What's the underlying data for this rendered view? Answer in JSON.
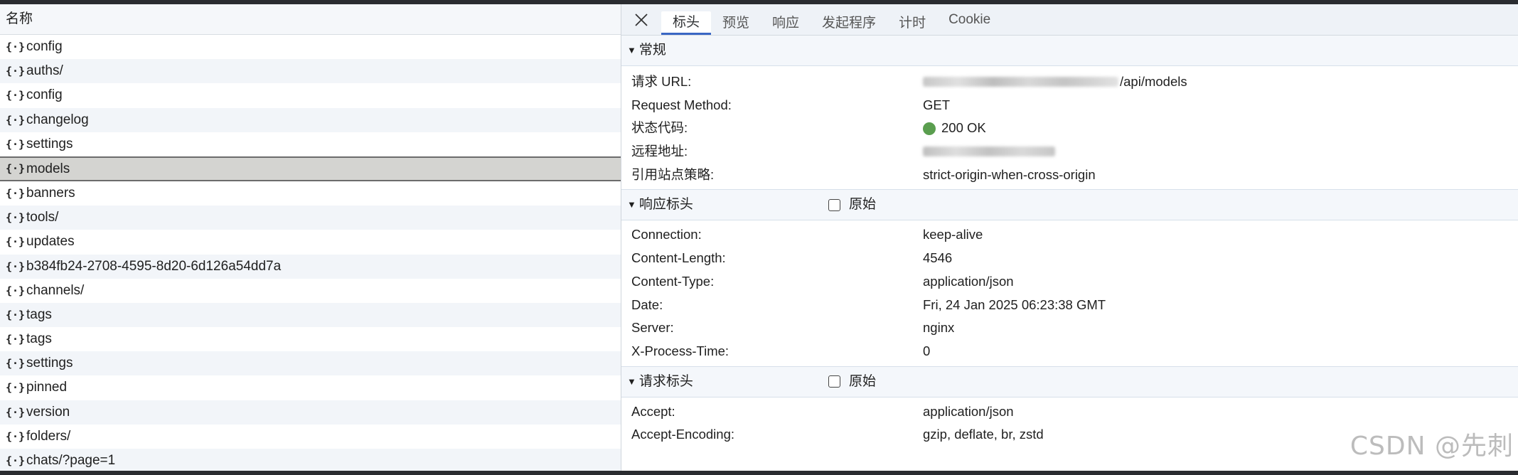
{
  "request_list": {
    "header": "名称",
    "icon": "json-braces-icon",
    "selected_index": 5,
    "items": [
      "config",
      "auths/",
      "config",
      "changelog",
      "settings",
      "models",
      "banners",
      "tools/",
      "updates",
      "b384fb24-2708-4595-8d20-6d126a54dd7a",
      "channels/",
      "tags",
      "tags",
      "settings",
      "pinned",
      "version",
      "folders/",
      "chats/?page=1"
    ]
  },
  "details": {
    "close_icon": "close-icon",
    "tabs": [
      "标头",
      "预览",
      "响应",
      "发起程序",
      "计时",
      "Cookie"
    ],
    "active_tab": "标头",
    "general": {
      "title": "常规",
      "request_url_label": "请求 URL:",
      "request_url_suffix": "/api/models",
      "method_label": "Request Method:",
      "method_value": "GET",
      "status_label": "状态代码:",
      "status_value": "200 OK",
      "status_color": "#5a9e4f",
      "remote_label": "远程地址:",
      "referrer_label": "引用站点策略:",
      "referrer_value": "strict-origin-when-cross-origin"
    },
    "response_headers": {
      "title": "响应标头",
      "raw_label": "原始",
      "rows": [
        {
          "k": "Connection:",
          "v": "keep-alive"
        },
        {
          "k": "Content-Length:",
          "v": "4546"
        },
        {
          "k": "Content-Type:",
          "v": "application/json"
        },
        {
          "k": "Date:",
          "v": "Fri, 24 Jan 2025 06:23:38 GMT"
        },
        {
          "k": "Server:",
          "v": "nginx"
        },
        {
          "k": "X-Process-Time:",
          "v": "0"
        }
      ]
    },
    "request_headers": {
      "title": "请求标头",
      "raw_label": "原始",
      "rows": [
        {
          "k": "Accept:",
          "v": "application/json"
        },
        {
          "k": "Accept-Encoding:",
          "v": "gzip, deflate, br, zstd"
        }
      ]
    }
  },
  "watermark": "CSDN @先刺",
  "colors": {
    "accent": "#3a67c4",
    "selected_row": "#d4d4d1",
    "status_ok": "#5a9e4f"
  }
}
